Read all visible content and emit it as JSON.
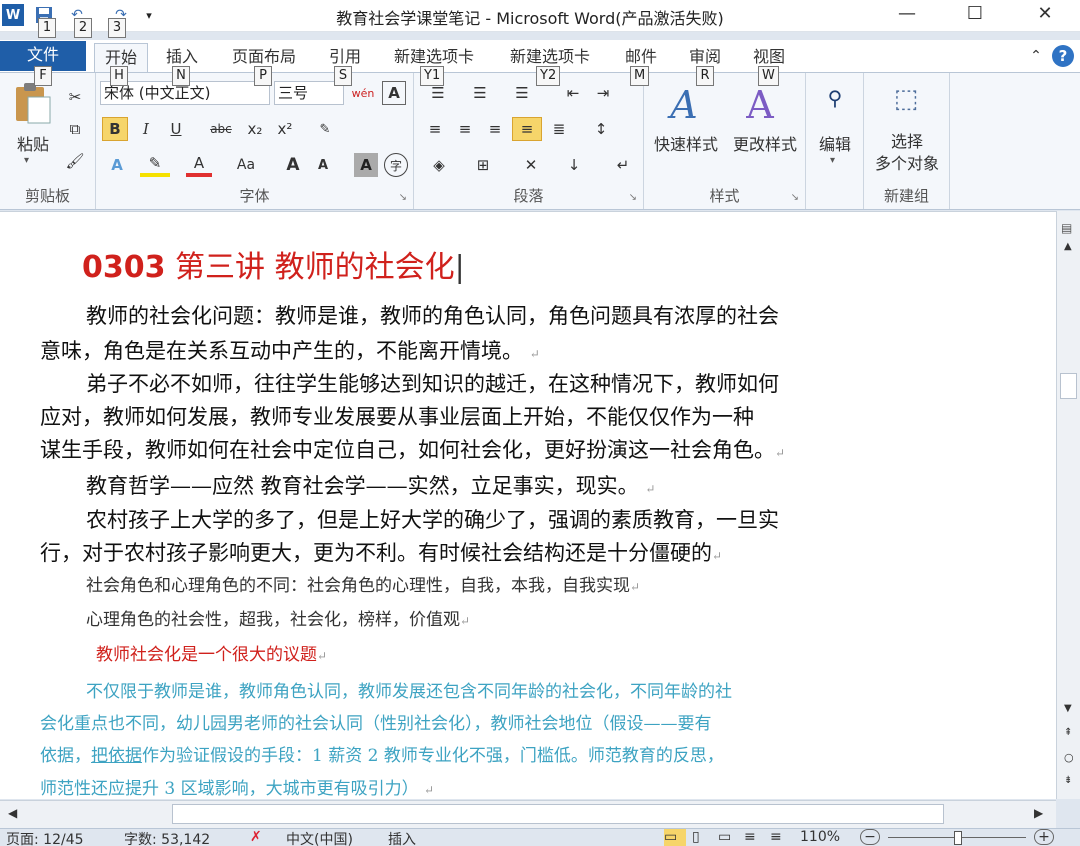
{
  "window": {
    "title": "教育社会学课堂笔记 - Microsoft Word(产品激活失败)"
  },
  "qat_keytips": [
    "1",
    "2",
    "3"
  ],
  "tabs": [
    {
      "label": "文件",
      "key": "F"
    },
    {
      "label": "开始",
      "key": "H"
    },
    {
      "label": "插入",
      "key": "N"
    },
    {
      "label": "页面布局",
      "key": "P"
    },
    {
      "label": "引用",
      "key": "S"
    },
    {
      "label": "新建选项卡",
      "key": "Y1"
    },
    {
      "label": "新建选项卡",
      "key": "Y2"
    },
    {
      "label": "邮件",
      "key": "M"
    },
    {
      "label": "审阅",
      "key": "R"
    },
    {
      "label": "视图",
      "key": "W"
    }
  ],
  "ribbon": {
    "clipboard": {
      "label": "剪贴板",
      "paste": "粘贴"
    },
    "font": {
      "label": "字体",
      "font_name": "宋体 (中文正文)",
      "font_size": "三号",
      "phonetic": "wén",
      "border_a": "A",
      "bold": "B",
      "italic": "I",
      "underline": "U",
      "strike": "abc",
      "sub": "x₂",
      "sup": "x²",
      "case": "Aa",
      "grow": "A",
      "shrink": "A",
      "shade_a": "A",
      "enclose": "字"
    },
    "paragraph": {
      "label": "段落"
    },
    "styles": {
      "label": "样式",
      "quick": "快速样式",
      "change": "更改样式"
    },
    "editing": {
      "label": "编辑"
    },
    "newgroup": {
      "label": "新建组",
      "select_line1": "选择",
      "select_line2": "多个对象"
    }
  },
  "document": {
    "heading_num": "0303",
    "heading_text": " 第三讲  教师的社会化",
    "p1_l1": "教师的社会化问题：教师是谁，教师的角色认同，角色问题具有浓厚的社会",
    "p1_l2": "意味，角色是在关系互动中产生的，不能离开情境。",
    "p2_l1": "弟子不必不如师，往往学生能够达到知识的越迁，在这种情况下，教师如何",
    "p2_l2": "应对，教师如何发展，教师专业发展要从事业层面上开始，不能仅仅作为一种",
    "p2_l3": "谋生手段，教师如何在社会中定位自己，如何社会化，更好扮演这一社会角色。",
    "p3_l1": "教育哲学——应然      教育社会学——实然，立足事实，现实。",
    "p4_l1": "农村孩子上大学的多了，但是上好大学的确少了，强调的素质教育，一旦实",
    "p4_l2": "行，对于农村孩子影响更大，更为不利。有时候社会结构还是十分僵硬的",
    "p5": "社会角色和心理角色的不同：社会角色的心理性，自我，本我，自我实现",
    "p6": "心理角色的社会性，超我，社会化，榜样，价值观",
    "p7": "教师社会化是一个很大的议题",
    "p8_l1": "不仅限于教师是谁，教师角色认同，教师发展还包含不同年龄的社会化，不同年龄的社",
    "p8_l2": "会化重点也不同，幼儿园男老师的社会认同（性别社会化），教师社会地位（假设——要有",
    "p8_l3a": "依据，",
    "p8_l3b": "把依据",
    "p8_l3c": "作为验证假设的手段：1 薪资 2 教师专业化不强，门槛低。师范教育的反思，",
    "p8_l4": "师范性还应提升 3 区域影响，大城市更有吸引力）",
    "para_mark": "↵"
  },
  "status": {
    "page": "页面: 12/45",
    "words": "字数: 53,142",
    "lang": "中文(中国)",
    "mode": "插入",
    "zoom": "110%"
  },
  "colors": {
    "accent": "#1f5ea8",
    "heading_red": "#d0211c",
    "note_cyan": "#3da3c2"
  }
}
